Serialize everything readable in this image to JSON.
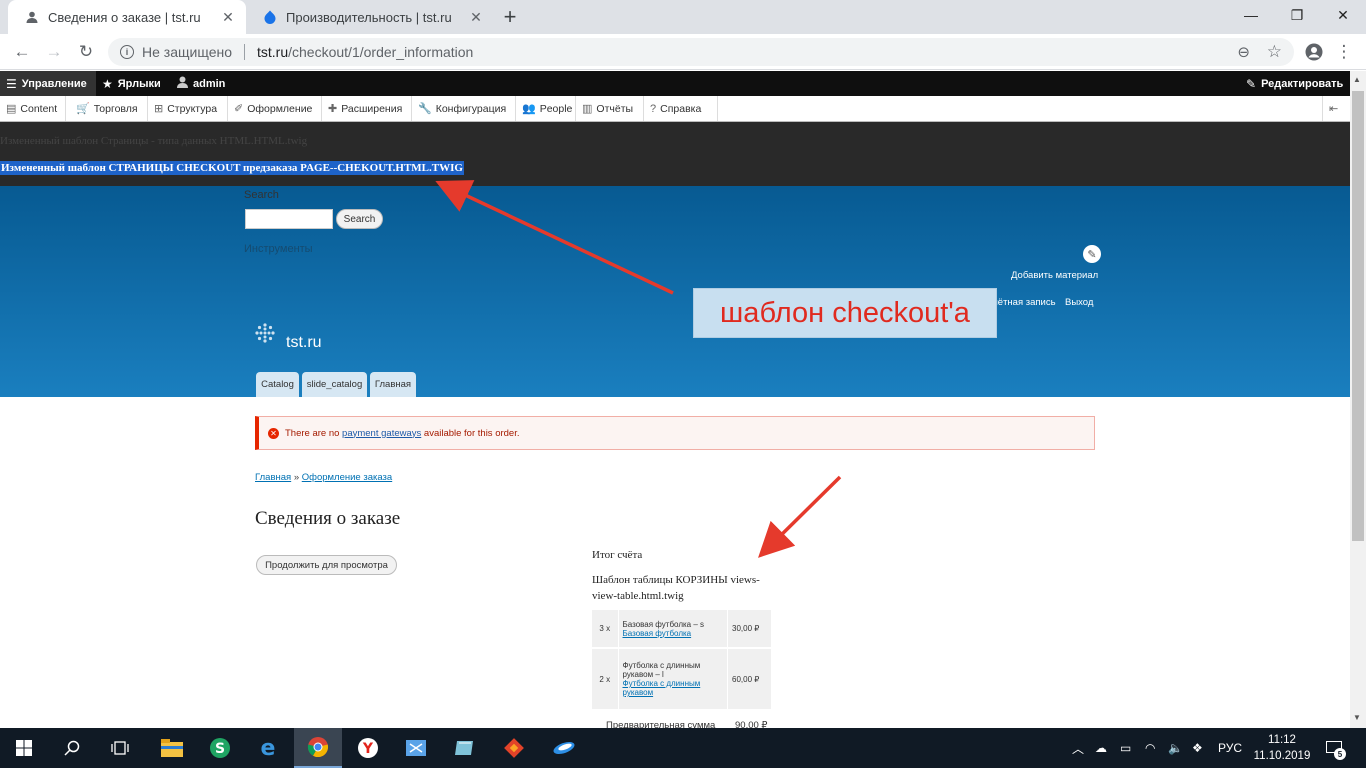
{
  "browser": {
    "tabs": [
      {
        "title": "Сведения о заказе | tst.ru",
        "active": true
      },
      {
        "title": "Производительность | tst.ru",
        "active": false
      }
    ],
    "omnibox": {
      "security": "Не защищено",
      "host": "tst.ru",
      "path": "/checkout/1/order_information"
    }
  },
  "admin": {
    "manage": "Управление",
    "shortcuts": "Ярлыки",
    "user": "admin",
    "edit": "Редактировать",
    "menu": [
      "Content",
      "Торговля",
      "Структура",
      "Оформление",
      "Расширения",
      "Конфигурация",
      "People",
      "Отчёты",
      "Справка"
    ]
  },
  "templates": {
    "page_muted": "Измененный шаблон Страницы - типа данных HTML.HTML.twig",
    "checkout_highlight": "Измененный шаблон СТРАНИЦЫ CHECKOUT предзаказа PAGE--CHEKOUT.HTML.TWIG"
  },
  "header": {
    "search_label": "Search",
    "search_button": "Search",
    "tools_label": "Инструменты",
    "add_material": "Добавить материал",
    "my_account": "Моя учётная запись",
    "logout": "Выход",
    "site_name": "tst.ru",
    "tabs": [
      "Catalog",
      "slide_catalog",
      "Главная"
    ]
  },
  "annotation": {
    "callout": "шаблон checkout'a"
  },
  "content": {
    "message_before": "There are no ",
    "message_link": "payment gateways",
    "message_after": " available for this order.",
    "breadcrumb": [
      "Главная",
      "Оформление заказа"
    ],
    "breadcrumb_sep": "»",
    "title": "Сведения о заказе",
    "continue": "Продолжить для просмотра",
    "order_total": "Итог счёта",
    "cart_template": "Шаблон таблицы КОРЗИНЫ views-view-table.html.twig",
    "items": [
      {
        "qty": "3 x",
        "name": "Базовая футболка – s",
        "link": "Базовая футболка",
        "price": "30,00 ₽"
      },
      {
        "qty": "2 x",
        "name": "Футболка с длинным рукавом – l",
        "link": "Футболка с длинным рукавом",
        "price": "60,00 ₽"
      }
    ],
    "subtotal_label": "Предварительная сумма",
    "subtotal_value": "90,00 ₽"
  },
  "taskbar": {
    "lang": "РУС",
    "time": "11:12",
    "date": "11.10.2019",
    "notifications": "5"
  },
  "colors": {
    "accent_arrow": "#e53a2c",
    "header_blue": "#0e6aa8",
    "highlight": "#1e63c9"
  }
}
